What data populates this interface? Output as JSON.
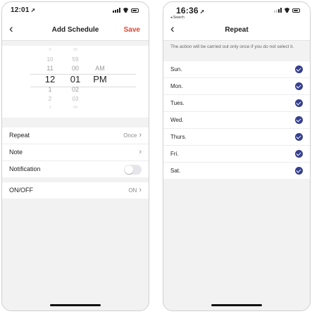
{
  "left": {
    "status": {
      "time": "12:01"
    },
    "nav": {
      "back": "‹",
      "title": "Add Schedule",
      "save": "Save"
    },
    "picker": {
      "hours": [
        "9",
        "10",
        "11",
        "12",
        "1",
        "2",
        "3"
      ],
      "minutes": [
        "58",
        "59",
        "00",
        "01",
        "02",
        "03",
        "04"
      ],
      "meridiem": [
        "",
        "",
        "AM",
        "PM",
        "",
        "",
        ""
      ]
    },
    "settings": [
      {
        "label": "Repeat",
        "value": "Once"
      },
      {
        "label": "Note",
        "value": ""
      },
      {
        "label": "Notification",
        "toggle": "off"
      }
    ],
    "onoff": {
      "label": "ON/OFF",
      "value": "ON"
    }
  },
  "right": {
    "status": {
      "time": "16:36",
      "back_label": "◂ Search"
    },
    "nav": {
      "back": "‹",
      "title": "Repeat"
    },
    "hint": "The action will be carried out only once if you do not select it.",
    "days": [
      "Sun.",
      "Mon.",
      "Tues.",
      "Wed.",
      "Thurs.",
      "Fri.",
      "Sat."
    ],
    "accent_color": "#36408e"
  }
}
